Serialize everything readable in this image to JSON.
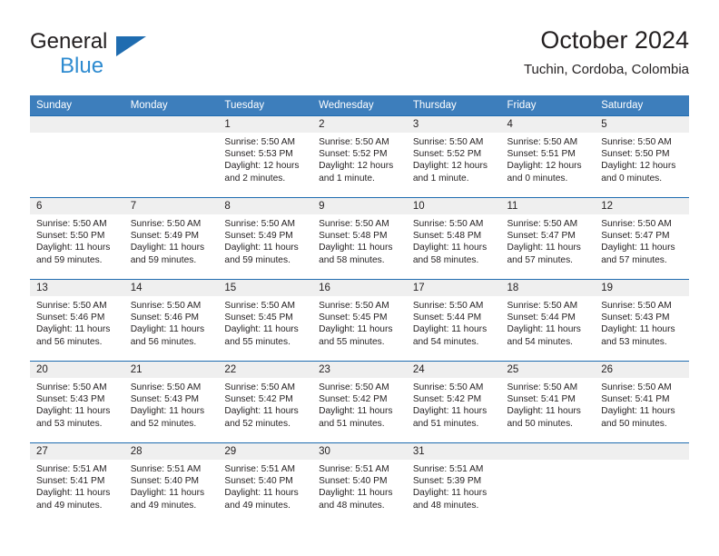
{
  "brand": {
    "name_part1": "General",
    "name_part2": "Blue",
    "logo_icon": "triangle-logo-icon"
  },
  "header": {
    "month_title": "October 2024",
    "location": "Tuchin, Cordoba, Colombia"
  },
  "colors": {
    "header_bar": "#3d7ebc",
    "cell_top_border": "#1f6cb0",
    "date_strip": "#efefef",
    "brand_blue": "#2e8bd0",
    "text": "#231f20"
  },
  "weekday_headers": [
    "Sunday",
    "Monday",
    "Tuesday",
    "Wednesday",
    "Thursday",
    "Friday",
    "Saturday"
  ],
  "weeks": [
    [
      {
        "empty": true
      },
      {
        "empty": true
      },
      {
        "date": "1",
        "sunrise": "Sunrise: 5:50 AM",
        "sunset": "Sunset: 5:53 PM",
        "daylight_line1": "Daylight: 12 hours",
        "daylight_line2": "and 2 minutes."
      },
      {
        "date": "2",
        "sunrise": "Sunrise: 5:50 AM",
        "sunset": "Sunset: 5:52 PM",
        "daylight_line1": "Daylight: 12 hours",
        "daylight_line2": "and 1 minute."
      },
      {
        "date": "3",
        "sunrise": "Sunrise: 5:50 AM",
        "sunset": "Sunset: 5:52 PM",
        "daylight_line1": "Daylight: 12 hours",
        "daylight_line2": "and 1 minute."
      },
      {
        "date": "4",
        "sunrise": "Sunrise: 5:50 AM",
        "sunset": "Sunset: 5:51 PM",
        "daylight_line1": "Daylight: 12 hours",
        "daylight_line2": "and 0 minutes."
      },
      {
        "date": "5",
        "sunrise": "Sunrise: 5:50 AM",
        "sunset": "Sunset: 5:50 PM",
        "daylight_line1": "Daylight: 12 hours",
        "daylight_line2": "and 0 minutes."
      }
    ],
    [
      {
        "date": "6",
        "sunrise": "Sunrise: 5:50 AM",
        "sunset": "Sunset: 5:50 PM",
        "daylight_line1": "Daylight: 11 hours",
        "daylight_line2": "and 59 minutes."
      },
      {
        "date": "7",
        "sunrise": "Sunrise: 5:50 AM",
        "sunset": "Sunset: 5:49 PM",
        "daylight_line1": "Daylight: 11 hours",
        "daylight_line2": "and 59 minutes."
      },
      {
        "date": "8",
        "sunrise": "Sunrise: 5:50 AM",
        "sunset": "Sunset: 5:49 PM",
        "daylight_line1": "Daylight: 11 hours",
        "daylight_line2": "and 59 minutes."
      },
      {
        "date": "9",
        "sunrise": "Sunrise: 5:50 AM",
        "sunset": "Sunset: 5:48 PM",
        "daylight_line1": "Daylight: 11 hours",
        "daylight_line2": "and 58 minutes."
      },
      {
        "date": "10",
        "sunrise": "Sunrise: 5:50 AM",
        "sunset": "Sunset: 5:48 PM",
        "daylight_line1": "Daylight: 11 hours",
        "daylight_line2": "and 58 minutes."
      },
      {
        "date": "11",
        "sunrise": "Sunrise: 5:50 AM",
        "sunset": "Sunset: 5:47 PM",
        "daylight_line1": "Daylight: 11 hours",
        "daylight_line2": "and 57 minutes."
      },
      {
        "date": "12",
        "sunrise": "Sunrise: 5:50 AM",
        "sunset": "Sunset: 5:47 PM",
        "daylight_line1": "Daylight: 11 hours",
        "daylight_line2": "and 57 minutes."
      }
    ],
    [
      {
        "date": "13",
        "sunrise": "Sunrise: 5:50 AM",
        "sunset": "Sunset: 5:46 PM",
        "daylight_line1": "Daylight: 11 hours",
        "daylight_line2": "and 56 minutes."
      },
      {
        "date": "14",
        "sunrise": "Sunrise: 5:50 AM",
        "sunset": "Sunset: 5:46 PM",
        "daylight_line1": "Daylight: 11 hours",
        "daylight_line2": "and 56 minutes."
      },
      {
        "date": "15",
        "sunrise": "Sunrise: 5:50 AM",
        "sunset": "Sunset: 5:45 PM",
        "daylight_line1": "Daylight: 11 hours",
        "daylight_line2": "and 55 minutes."
      },
      {
        "date": "16",
        "sunrise": "Sunrise: 5:50 AM",
        "sunset": "Sunset: 5:45 PM",
        "daylight_line1": "Daylight: 11 hours",
        "daylight_line2": "and 55 minutes."
      },
      {
        "date": "17",
        "sunrise": "Sunrise: 5:50 AM",
        "sunset": "Sunset: 5:44 PM",
        "daylight_line1": "Daylight: 11 hours",
        "daylight_line2": "and 54 minutes."
      },
      {
        "date": "18",
        "sunrise": "Sunrise: 5:50 AM",
        "sunset": "Sunset: 5:44 PM",
        "daylight_line1": "Daylight: 11 hours",
        "daylight_line2": "and 54 minutes."
      },
      {
        "date": "19",
        "sunrise": "Sunrise: 5:50 AM",
        "sunset": "Sunset: 5:43 PM",
        "daylight_line1": "Daylight: 11 hours",
        "daylight_line2": "and 53 minutes."
      }
    ],
    [
      {
        "date": "20",
        "sunrise": "Sunrise: 5:50 AM",
        "sunset": "Sunset: 5:43 PM",
        "daylight_line1": "Daylight: 11 hours",
        "daylight_line2": "and 53 minutes."
      },
      {
        "date": "21",
        "sunrise": "Sunrise: 5:50 AM",
        "sunset": "Sunset: 5:43 PM",
        "daylight_line1": "Daylight: 11 hours",
        "daylight_line2": "and 52 minutes."
      },
      {
        "date": "22",
        "sunrise": "Sunrise: 5:50 AM",
        "sunset": "Sunset: 5:42 PM",
        "daylight_line1": "Daylight: 11 hours",
        "daylight_line2": "and 52 minutes."
      },
      {
        "date": "23",
        "sunrise": "Sunrise: 5:50 AM",
        "sunset": "Sunset: 5:42 PM",
        "daylight_line1": "Daylight: 11 hours",
        "daylight_line2": "and 51 minutes."
      },
      {
        "date": "24",
        "sunrise": "Sunrise: 5:50 AM",
        "sunset": "Sunset: 5:42 PM",
        "daylight_line1": "Daylight: 11 hours",
        "daylight_line2": "and 51 minutes."
      },
      {
        "date": "25",
        "sunrise": "Sunrise: 5:50 AM",
        "sunset": "Sunset: 5:41 PM",
        "daylight_line1": "Daylight: 11 hours",
        "daylight_line2": "and 50 minutes."
      },
      {
        "date": "26",
        "sunrise": "Sunrise: 5:50 AM",
        "sunset": "Sunset: 5:41 PM",
        "daylight_line1": "Daylight: 11 hours",
        "daylight_line2": "and 50 minutes."
      }
    ],
    [
      {
        "date": "27",
        "sunrise": "Sunrise: 5:51 AM",
        "sunset": "Sunset: 5:41 PM",
        "daylight_line1": "Daylight: 11 hours",
        "daylight_line2": "and 49 minutes."
      },
      {
        "date": "28",
        "sunrise": "Sunrise: 5:51 AM",
        "sunset": "Sunset: 5:40 PM",
        "daylight_line1": "Daylight: 11 hours",
        "daylight_line2": "and 49 minutes."
      },
      {
        "date": "29",
        "sunrise": "Sunrise: 5:51 AM",
        "sunset": "Sunset: 5:40 PM",
        "daylight_line1": "Daylight: 11 hours",
        "daylight_line2": "and 49 minutes."
      },
      {
        "date": "30",
        "sunrise": "Sunrise: 5:51 AM",
        "sunset": "Sunset: 5:40 PM",
        "daylight_line1": "Daylight: 11 hours",
        "daylight_line2": "and 48 minutes."
      },
      {
        "date": "31",
        "sunrise": "Sunrise: 5:51 AM",
        "sunset": "Sunset: 5:39 PM",
        "daylight_line1": "Daylight: 11 hours",
        "daylight_line2": "and 48 minutes."
      },
      {
        "empty": true
      },
      {
        "empty": true
      }
    ]
  ]
}
